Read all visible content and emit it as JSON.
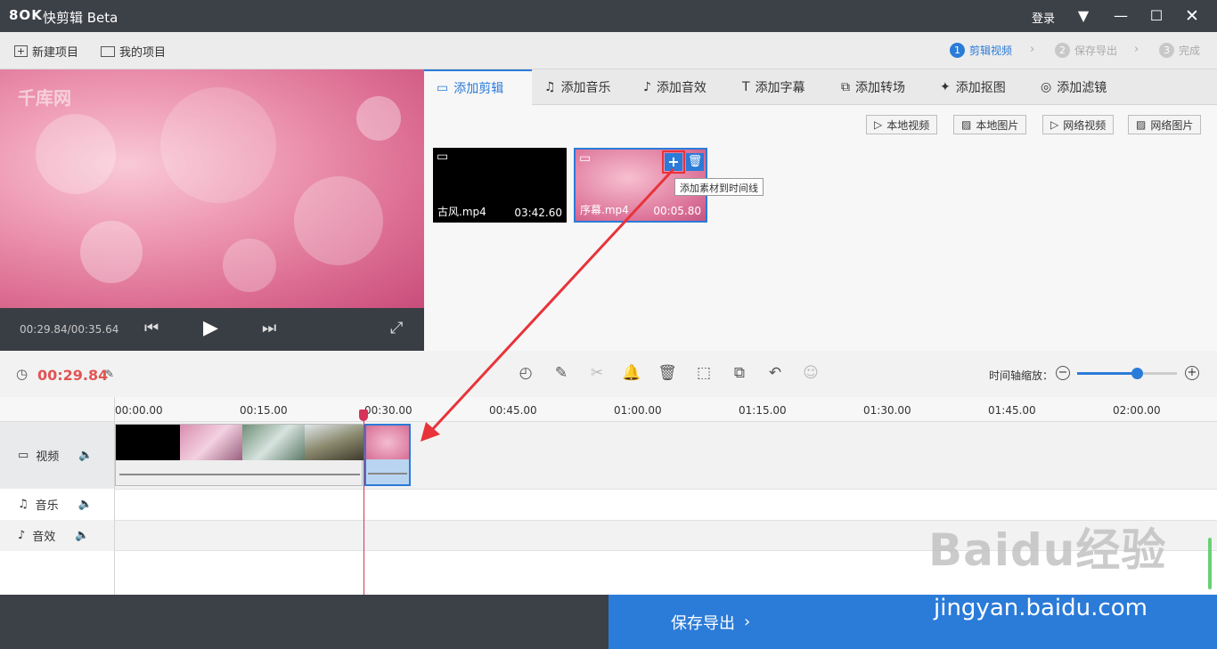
{
  "app": {
    "title": "快剪辑 Beta",
    "logo": "8OK"
  },
  "titlebar": {
    "login": "登录",
    "icons": [
      "menu-icon",
      "minimize-icon",
      "maximize-icon",
      "close-icon"
    ]
  },
  "toolbar": {
    "new_project": "新建项目",
    "my_projects": "我的项目",
    "steps": [
      {
        "num": "1",
        "label": "剪辑视频"
      },
      {
        "num": "2",
        "label": "保存导出"
      },
      {
        "num": "3",
        "label": "完成"
      }
    ]
  },
  "preview": {
    "watermark": "千库网",
    "timecode": "00:29.84/00:35.64"
  },
  "tabs": [
    "添加剪辑",
    "添加音乐",
    "添加音效",
    "添加字幕",
    "添加转场",
    "添加抠图",
    "添加滤镜"
  ],
  "source_buttons": [
    "本地视频",
    "本地图片",
    "网络视频",
    "网络图片"
  ],
  "clips": [
    {
      "name": "古风.mp4",
      "duration": "03:42.60"
    },
    {
      "name": "序幕.mp4",
      "duration": "00:05.80"
    }
  ],
  "tooltip": "添加素材到时间线",
  "timeline": {
    "current_time": "00:29.84",
    "zoom_label": "时间轴缩放：",
    "zoom_level": 0.6,
    "ticks": [
      "00:00.00",
      "00:15.00",
      "00:30.00",
      "00:45.00",
      "01:00.00",
      "01:15.00",
      "01:30.00",
      "01:45.00",
      "02:00.00"
    ],
    "tracks": [
      "视频",
      "音乐",
      "音效"
    ]
  },
  "export_button": "保存导出",
  "baidu": {
    "mark": "Baidu经验",
    "url": "jingyan.baidu.com"
  },
  "colors": {
    "accent": "#2b7bd8",
    "time": "#e35454",
    "highlight": "#e8333a"
  }
}
